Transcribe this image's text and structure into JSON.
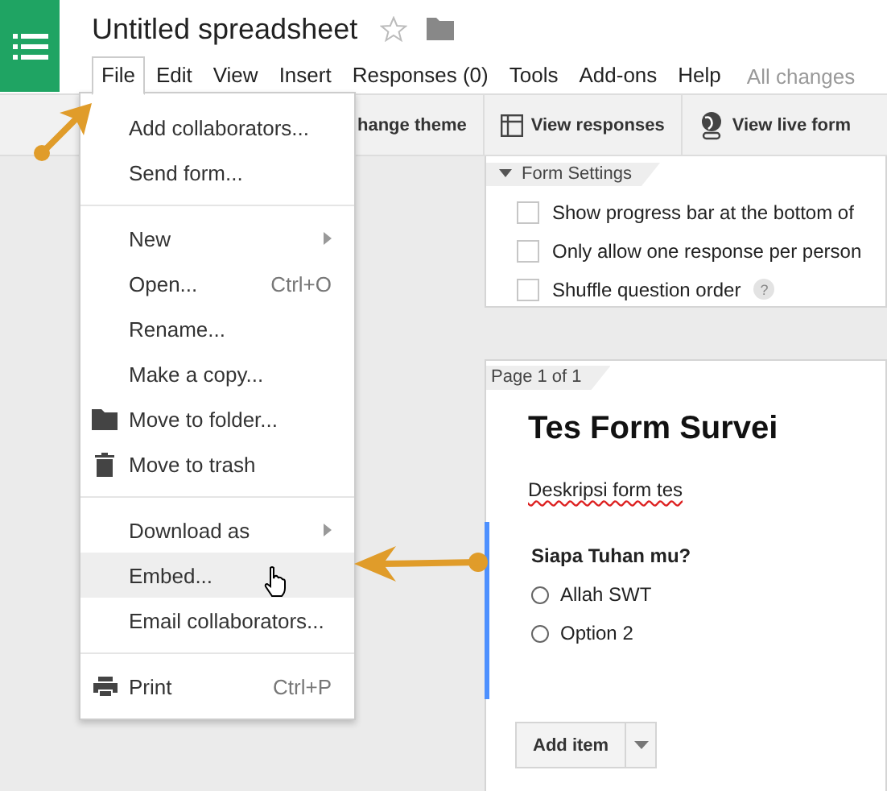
{
  "document": {
    "title": "Untitled spreadsheet",
    "save_status": "All changes"
  },
  "menubar": [
    {
      "label": "File",
      "selected": true
    },
    {
      "label": "Edit",
      "selected": false
    },
    {
      "label": "View",
      "selected": false
    },
    {
      "label": "Insert",
      "selected": false
    },
    {
      "label": "Responses (0)",
      "selected": false
    },
    {
      "label": "Tools",
      "selected": false
    },
    {
      "label": "Add-ons",
      "selected": false
    },
    {
      "label": "Help",
      "selected": false
    }
  ],
  "toolbar": [
    {
      "label": "hange theme",
      "kind": "plain"
    },
    {
      "label": "View responses",
      "kind": "table"
    },
    {
      "label": "View live form",
      "kind": "globe"
    }
  ],
  "file_menu": [
    [
      {
        "label": "Add collaborators...",
        "kind": "plain",
        "submenu": false,
        "selected": false
      },
      {
        "label": "Send form...",
        "kind": "plain",
        "submenu": false,
        "selected": false
      }
    ],
    [
      {
        "label": "New",
        "kind": "plain",
        "submenu": true,
        "selected": false
      },
      {
        "label": "Open...",
        "kind": "plain",
        "shortcut": "Ctrl+O",
        "submenu": false,
        "selected": false
      },
      {
        "label": "Rename...",
        "kind": "plain",
        "submenu": false,
        "selected": false
      },
      {
        "label": "Make a copy...",
        "kind": "plain",
        "submenu": false,
        "selected": false
      },
      {
        "label": "Move to folder...",
        "kind": "folder",
        "submenu": false,
        "selected": false
      },
      {
        "label": "Move to trash",
        "kind": "trash",
        "submenu": false,
        "selected": false
      }
    ],
    [
      {
        "label": "Download as",
        "kind": "plain",
        "submenu": true,
        "selected": false
      },
      {
        "label": "Embed...",
        "kind": "plain",
        "submenu": false,
        "selected": true
      },
      {
        "label": "Email collaborators...",
        "kind": "plain",
        "submenu": false,
        "selected": false
      }
    ],
    [
      {
        "label": "Print",
        "kind": "print",
        "shortcut": "Ctrl+P",
        "submenu": false,
        "selected": false
      }
    ]
  ],
  "form_settings": {
    "title": "Form Settings",
    "expanded": true,
    "options": [
      {
        "label": "Show progress bar at the bottom of",
        "checked": false
      },
      {
        "label": "Only allow one response per person",
        "checked": false
      },
      {
        "label": "Shuffle question order",
        "checked": false,
        "help": "?"
      }
    ]
  },
  "page": {
    "tab": "Page 1 of 1",
    "title": "Tes Form Survei",
    "description": "Deskripsi form tes",
    "question": {
      "title": "Siapa Tuhan mu?",
      "active": true,
      "options": [
        {
          "label": "Allah SWT",
          "selected": false
        },
        {
          "label": "Option 2",
          "selected": false
        }
      ]
    },
    "add_button": "Add item"
  }
}
